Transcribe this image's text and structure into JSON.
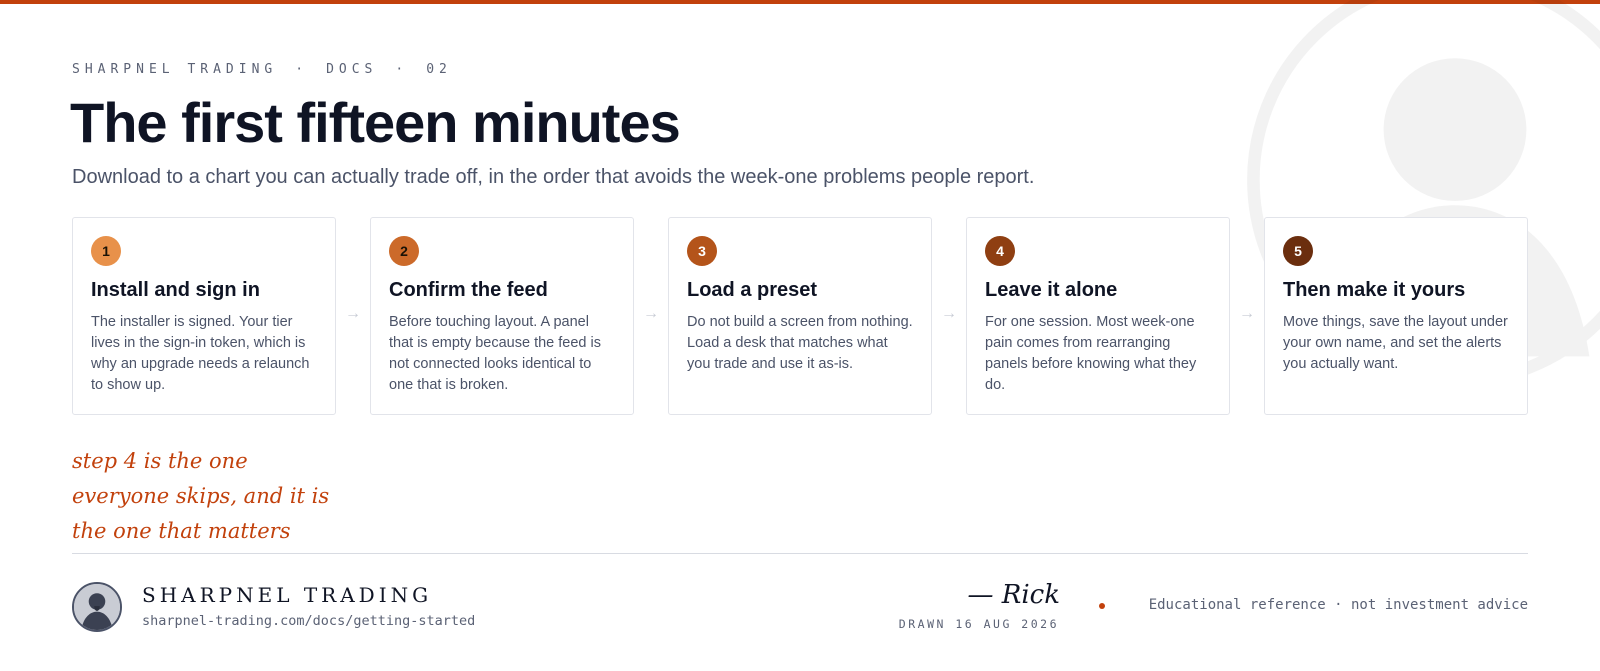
{
  "colors": {
    "accent": "#c2410c",
    "step_badges": [
      "#e8914a",
      "#cc6a2a",
      "#b4541a",
      "#8f3f12",
      "#6b2e0e"
    ],
    "step_badge_text": [
      "#1a1206",
      "#1a1206",
      "#ffffff",
      "#ffffff",
      "#ffffff"
    ]
  },
  "header": {
    "eyebrow": {
      "brand": "SHARPNEL TRADING",
      "separator": "·",
      "section": "DOCS",
      "number": "02"
    },
    "title": "The first fifteen minutes",
    "subtitle": "Download to a chart you can actually trade off, in the order that avoids the week-one problems people report."
  },
  "steps": [
    {
      "number": "1",
      "title": "Install and sign in",
      "body": "The installer is signed. Your tier lives in the sign-in token, which is why an upgrade needs a relaunch to show up."
    },
    {
      "number": "2",
      "title": "Confirm the feed",
      "body": "Before touching layout. A panel that is empty because the feed is not connected looks identical to one that is broken."
    },
    {
      "number": "3",
      "title": "Load a preset",
      "body": "Do not build a screen from nothing. Load a desk that matches what you trade and use it as-is."
    },
    {
      "number": "4",
      "title": "Leave it alone",
      "body": "For one session. Most week-one pain comes from rearranging panels before knowing what they do."
    },
    {
      "number": "5",
      "title": "Then make it yours",
      "body": "Move things, save the layout under your own name, and set the alerts you actually want."
    }
  ],
  "arrow_glyph": "→",
  "note": {
    "lines": [
      "step 4 is the one",
      "everyone skips, and it is",
      "the one that matters"
    ]
  },
  "footer": {
    "avatar_icon": "bearded-bust-portrait",
    "brand_name": "SHARPNEL TRADING",
    "url": "sharpnel-trading.com/docs/getting-started",
    "signature": "— Rick",
    "drawn": "DRAWN 16 AUG 2026",
    "disclaimer": "Educational reference · not investment advice"
  }
}
